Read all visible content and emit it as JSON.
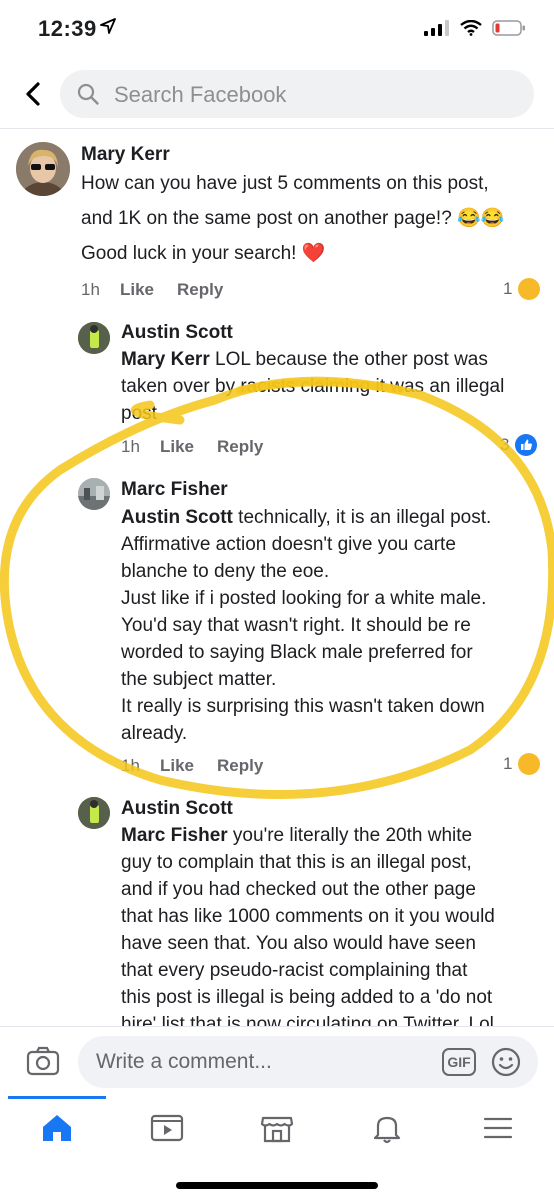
{
  "status": {
    "time": "12:39",
    "battery_color": "#e53935"
  },
  "search": {
    "placeholder": "Search Facebook"
  },
  "comments": [
    {
      "name": "Mary Kerr",
      "lines": [
        "How can you have just 5 comments on this post,",
        "and 1K on the same post on another page!? 😂😂",
        "Good luck in your search! ❤️"
      ],
      "time": "1h",
      "like": "Like",
      "reply": "Reply",
      "reaction_count": "1"
    },
    {
      "name": "Austin Scott",
      "mention": "Mary Kerr",
      "lines": [
        " LOL because the other post was",
        "taken over by racists claiming it was an illegal",
        "post"
      ],
      "time": "1h",
      "like": "Like",
      "reply": "Reply",
      "reaction_count": "3"
    },
    {
      "name": "Marc Fisher",
      "mention": "Austin Scott",
      "lines": [
        " technically, it is an illegal post.",
        "Affirmative action doesn't give you carte",
        "blanche to deny the eoe.",
        "Just like if i posted looking for a white male.",
        "You'd say that wasn't right. It should be re",
        "worded to saying Black male preferred for",
        "the subject matter.",
        "It really is surprising this wasn't taken down",
        "already."
      ],
      "time": "1h",
      "like": "Like",
      "reply": "Reply",
      "reaction_count": "1"
    },
    {
      "name": "Austin Scott",
      "mention": "Marc Fisher",
      "lines": [
        " you're literally the 20th white",
        "guy to complain that this is an illegal post,",
        "and if you had checked out the other page",
        "that has like 1000 comments on it you would",
        "have seen that. You also would have seen",
        "that every pseudo-racist complaining that",
        "this post is illegal is being added to a 'do not",
        "hire' list that is now circulating on Twitter. Lol"
      ]
    }
  ],
  "composer": {
    "placeholder": "Write a comment...",
    "gif": "GIF"
  },
  "colors": {
    "accent": "#1877f2",
    "annotation": "#f5c518",
    "haha_emoji": "#f7b928"
  },
  "icons": [
    "chevron-left-icon",
    "search-icon",
    "location-arrow-icon",
    "signal-icon",
    "wifi-icon",
    "battery-icon",
    "camera-icon",
    "smile-icon",
    "home-icon",
    "video-icon",
    "marketplace-icon",
    "bell-icon",
    "menu-icon"
  ]
}
